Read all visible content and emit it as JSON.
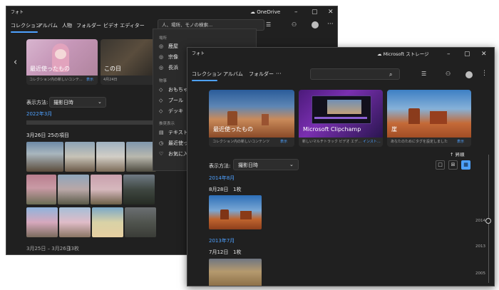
{
  "back_window": {
    "title": "フォト",
    "onedrive": "OneDrive",
    "tabs": [
      "コレクション",
      "アルバム",
      "人物",
      "フォルダー",
      "ビデオ エディター"
    ],
    "search_placeholder": "人、場所、モノの検索...",
    "cards": [
      {
        "title": "最近使ったもの",
        "subtitle": "コレクション内の新しいコンテ...",
        "action": "表示"
      },
      {
        "title": "この日",
        "date": "4月24日"
      }
    ],
    "sort_label": "表示方法:",
    "sort_value": "撮影日時",
    "month_header": "2022年3月",
    "date_group": "3月26日",
    "date_group_count": "25の項目",
    "bottom_range": "3月25日 – 3月26日",
    "bottom_count": "13枚"
  },
  "search_menu": {
    "sections": [
      {
        "header": "場所",
        "items": [
          {
            "label": "鹿屋",
            "icon": "location-pin-icon"
          },
          {
            "label": "宗像",
            "icon": "location-pin-icon"
          },
          {
            "label": "長浜",
            "icon": "location-pin-icon"
          }
        ]
      },
      {
        "header": "物事",
        "items": [
          {
            "label": "おもちゃ",
            "icon": "tag-icon"
          },
          {
            "label": "プール",
            "icon": "tag-icon"
          },
          {
            "label": "デッキ",
            "icon": "tag-icon"
          }
        ]
      },
      {
        "header": "推奨表示",
        "items": [
          {
            "label": "テキスト",
            "icon": "text-icon"
          },
          {
            "label": "最近使った",
            "icon": "clock-icon"
          },
          {
            "label": "お気に入り",
            "icon": "heart-icon"
          }
        ]
      }
    ]
  },
  "front_window": {
    "title": "フォト",
    "storage": "Microsoft ストレージ",
    "tabs": [
      "コレクション",
      "アルバム",
      "フォルダー"
    ],
    "more": "···",
    "cards": [
      {
        "title": "最近使ったもの",
        "subtitle": "コレクション内の新しいコンテンツ",
        "action": "表示"
      },
      {
        "title": "Microsoft Clipchamp",
        "subtitle": "新しいマルチトラック ビデオ エデ...",
        "action": "インスト..."
      },
      {
        "title": "崖",
        "subtitle": "あなたのためにタグを設定しました",
        "action": "表示"
      }
    ],
    "sort_label": "表示方法:",
    "sort_value": "撮影日時",
    "ascending": "昇順",
    "groups": [
      {
        "month": "2014年8月",
        "day": "8月28日",
        "count": "1枚"
      },
      {
        "month": "2013年7月",
        "day": "7月12日",
        "count": "1枚"
      }
    ],
    "timeline_years": [
      "2014",
      "2013",
      "2005"
    ]
  },
  "colors": {
    "accent": "#4ea1ff",
    "window_bg": "#202020",
    "card_bg": "#2b2b2b"
  }
}
